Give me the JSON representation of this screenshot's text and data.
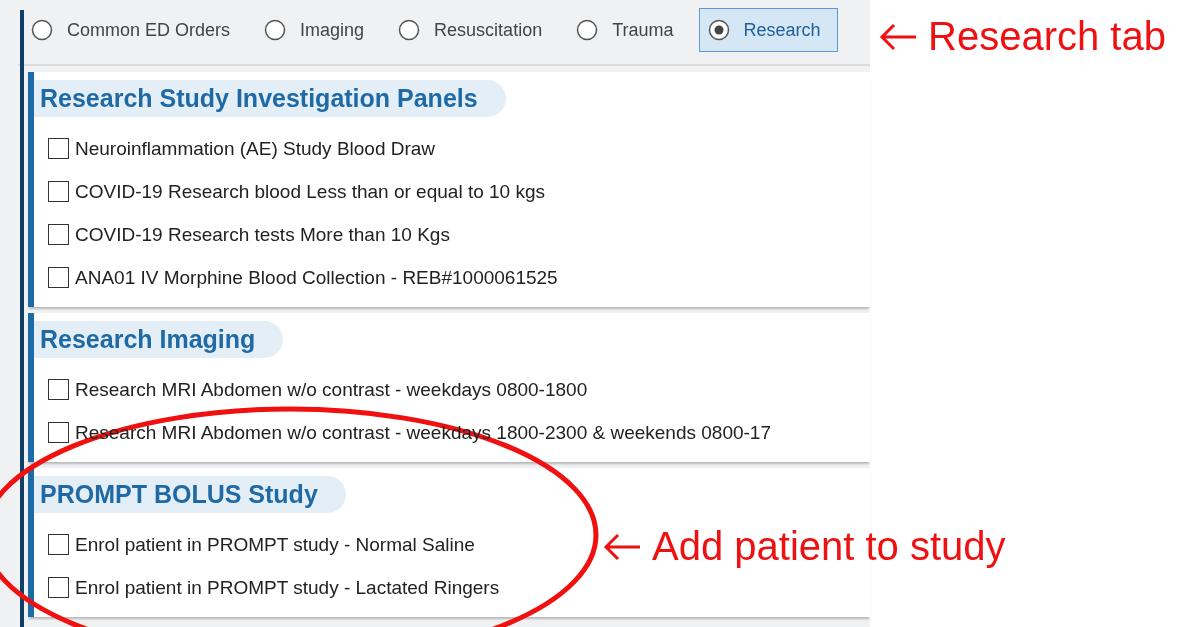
{
  "tabs": [
    {
      "label": "Common ED Orders",
      "selected": false
    },
    {
      "label": "Imaging",
      "selected": false
    },
    {
      "label": "Resuscitation",
      "selected": false
    },
    {
      "label": "Trauma",
      "selected": false
    },
    {
      "label": "Research",
      "selected": true
    }
  ],
  "sections": [
    {
      "title": "Research Study Investigation Panels",
      "items": [
        {
          "label": "Neuroinflammation (AE) Study Blood Draw",
          "checked": false
        },
        {
          "label": "COVID-19 Research blood Less than or equal to 10 kgs",
          "checked": false
        },
        {
          "label": "COVID-19 Research tests More than 10 Kgs",
          "checked": false
        },
        {
          "label": "ANA01 IV Morphine Blood Collection - REB#1000061525",
          "checked": false
        }
      ]
    },
    {
      "title": "Research Imaging",
      "items": [
        {
          "label": "Research MRI Abdomen w/o contrast - weekdays 0800-1800",
          "checked": false
        },
        {
          "label": "Research MRI Abdomen w/o contrast - weekdays 1800-2300 & weekends 0800-17",
          "checked": false
        }
      ]
    },
    {
      "title": "PROMPT BOLUS Study",
      "items": [
        {
          "label": "Enrol patient in PROMPT study - Normal Saline",
          "checked": false
        },
        {
          "label": "Enrol patient in PROMPT study - Lactated Ringers",
          "checked": false
        }
      ]
    }
  ],
  "annotations": [
    {
      "text": "Research tab"
    },
    {
      "text": "Add patient to study"
    }
  ]
}
